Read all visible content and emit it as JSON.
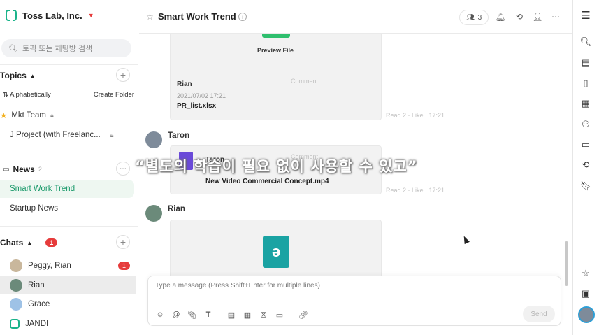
{
  "sidebar": {
    "team_name": "Toss Lab, Inc.",
    "search_placeholder": "토픽 또는 채팅방 검색",
    "topics_label": "Topics",
    "sort_label": "Alphabetically",
    "create_folder_label": "Create Folder",
    "topics": [
      {
        "label": "Mkt Team",
        "starred": true,
        "locked": true
      },
      {
        "label": "J Project (with Freelanc...",
        "starred": false,
        "locked": true
      }
    ],
    "news_label": "News",
    "news_count": "2",
    "news_items": [
      {
        "label": "Smart Work Trend",
        "active": true
      },
      {
        "label": "Startup News",
        "active": false
      }
    ],
    "chats_label": "Chats",
    "chats_badge": "1",
    "chats": [
      {
        "label": "Peggy, Rian",
        "badge": "1",
        "active": false
      },
      {
        "label": "Rian",
        "badge": "",
        "active": true
      },
      {
        "label": "Grace",
        "badge": "",
        "active": false
      },
      {
        "label": "JANDI",
        "badge": "",
        "active": false
      }
    ]
  },
  "header": {
    "title": "Smart Work Trend",
    "member_count": "3"
  },
  "messages": {
    "preview_label": "Preview File",
    "file1": {
      "owner": "Rian",
      "date": "2021/07/02 17:21",
      "name": "PR_list.xlsx",
      "comment": "Comment",
      "meta": "Read 2 · Like · 17:21"
    },
    "sender2": "Taron",
    "file2": {
      "owner": "Taron",
      "name": "New Video Commercial Concept.mp4",
      "comment": "Comment",
      "meta": "Read 2 · Like · 17:21"
    },
    "sender3": "Rian",
    "subtitle": "“별도의 학습이 필요 없이 사용할 수 있고”"
  },
  "composer": {
    "placeholder": "Type a message (Press Shift+Enter for multiple lines)",
    "send_label": "Send"
  },
  "colors": {
    "accent": "#1bb38a",
    "badge": "#e63b3b",
    "active_topic_bg": "#eef7f1"
  }
}
